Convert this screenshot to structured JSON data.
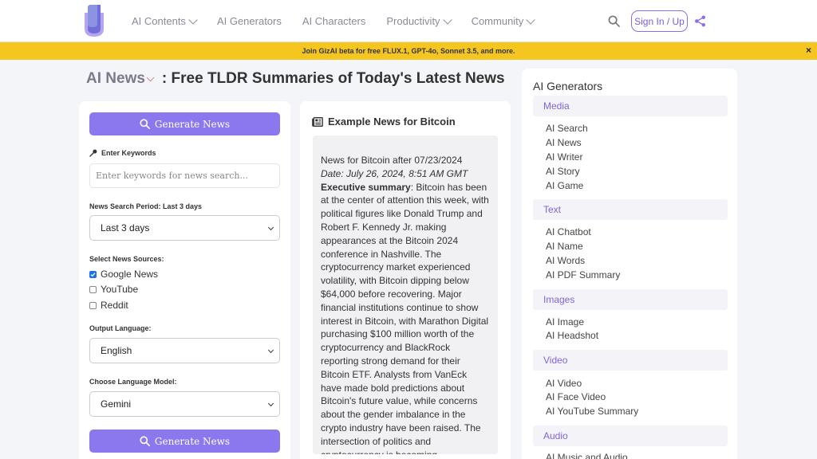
{
  "nav": {
    "links": [
      {
        "label": "AI Contents",
        "dropdown": true
      },
      {
        "label": "AI Generators",
        "dropdown": false
      },
      {
        "label": "AI Characters",
        "dropdown": false
      },
      {
        "label": "Productivity",
        "dropdown": true
      },
      {
        "label": "Community",
        "dropdown": true
      }
    ],
    "signin_label": "Sign In / Up",
    "icons": [
      "logo-icon",
      "search-icon",
      "share-icon"
    ]
  },
  "banner": {
    "text": "Join GizAI beta for free FLUX.1, GPT-4o, Sonnet 3.5, and more.",
    "close": "×"
  },
  "page": {
    "title_prefix": "AI News",
    "title_rest": ": Free TLDR Summaries of Today's Latest News"
  },
  "form": {
    "generate_label": "Generate News",
    "keywords_label": "Enter Keywords",
    "keywords_placeholder": "Enter keywords for news search...",
    "period_label": "News Search Period: Last 3 days",
    "period_value": "Last 3 days",
    "sources_label": "Select News Sources:",
    "sources": [
      {
        "label": "Google News",
        "checked": true
      },
      {
        "label": "YouTube",
        "checked": false
      },
      {
        "label": "Reddit",
        "checked": false
      }
    ],
    "language_label": "Output Language:",
    "language_value": "English",
    "model_label": "Choose Language Model:",
    "model_value": "Gemini"
  },
  "news": {
    "heading": "Example News for Bitcoin",
    "line1": "News for Bitcoin after 07/23/2024",
    "date": "Date: July 26, 2024, 8:51 AM GMT",
    "summary_label": "Executive summary",
    "summary_text": ": Bitcoin has been at the center of attention this week, with political figures like Donald Trump and Robert F. Kennedy Jr. making appearances at the Bitcoin 2024 conference in Nashville. The cryptocurrency market experienced volatility, with Bitcoin dipping below $64,000 before recovering. Major financial institutions continue to show interest in Bitcoin, with Marathon Digital purchasing $100 million worth of the cryptocurrency and BlackRock reporting strong demand for their Bitcoin ETF. Analysts from VanEck have made bold predictions about Bitcoin's future value, while concerns about the gender imbalance in the crypto industry have been raised. The intersection of politics and cryptocurrency is becoming"
  },
  "sidebar": {
    "title": "AI Generators",
    "categories": [
      {
        "name": "Media",
        "items": [
          "AI Search",
          "AI News",
          "AI Writer",
          "AI Story",
          "AI Game"
        ]
      },
      {
        "name": "Text",
        "items": [
          "AI Chatbot",
          "AI Name",
          "AI Words",
          "AI PDF Summary"
        ]
      },
      {
        "name": "Images",
        "items": [
          "AI Image",
          "AI Headshot"
        ]
      },
      {
        "name": "Video",
        "items": [
          "AI Video",
          "AI Face Video",
          "AI YouTube Summary"
        ]
      },
      {
        "name": "Audio",
        "items": [
          "AI Music and Audio"
        ]
      }
    ]
  }
}
